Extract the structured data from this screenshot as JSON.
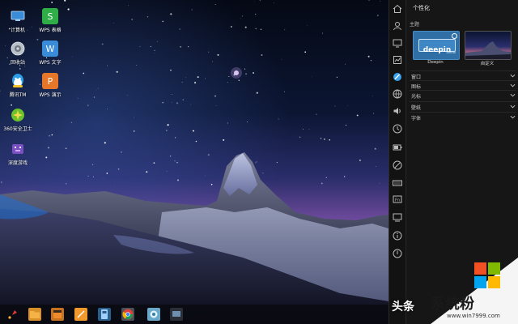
{
  "desktop": {
    "icons": [
      {
        "label": "计算机",
        "icon": "computer-icon",
        "color": "#3a8bd8"
      },
      {
        "label": "WPS 表格",
        "icon": "wps-sheet-icon",
        "color": "#2fae47",
        "glyph": "S"
      },
      {
        "label": "回收站",
        "icon": "trash-icon",
        "color": "#9aa3ad"
      },
      {
        "label": "WPS 文字",
        "icon": "wps-writer-icon",
        "color": "#3a8bd8",
        "glyph": "W"
      },
      {
        "label": "腾讯TM",
        "icon": "tencent-tm-icon",
        "color": "#2a9de6"
      },
      {
        "label": "WPS 演示",
        "icon": "wps-presentation-icon",
        "color": "#e6762a",
        "glyph": "P"
      },
      {
        "label": "360安全卫士",
        "icon": "security-360-icon",
        "color": "#6ac22d"
      },
      {
        "label": "深度游戏",
        "icon": "game-icon",
        "color": "#7b4fc2"
      }
    ]
  },
  "panel": {
    "title": "个性化",
    "theme_section": "主题",
    "themes": [
      {
        "label": "Deepin",
        "logo": "deepin",
        "sub": "official"
      },
      {
        "label": "自定义"
      }
    ],
    "rows": [
      "窗口",
      "图标",
      "光标",
      "壁纸",
      "字体"
    ],
    "rail_icons": [
      "home-icon",
      "account-icon",
      "display-icon",
      "default-apps-icon",
      "personalization-icon",
      "network-icon",
      "sound-icon",
      "datetime-icon",
      "power-icon",
      "mouse-icon",
      "keyboard-icon",
      "shortcuts-icon",
      "system-info-icon",
      "update-icon"
    ]
  },
  "taskbar": {
    "items": [
      "launcher-icon",
      "file-manager-icon",
      "app-store-icon",
      "files-icon",
      "terminal-icon",
      "chrome-icon",
      "control-center-icon",
      "screen-icon"
    ]
  },
  "watermark": {
    "left_text": "头条",
    "site": "系统粉",
    "url": "www.win7999.com",
    "colors": [
      "#f25022",
      "#7fba00",
      "#00a4ef",
      "#ffb900"
    ]
  }
}
